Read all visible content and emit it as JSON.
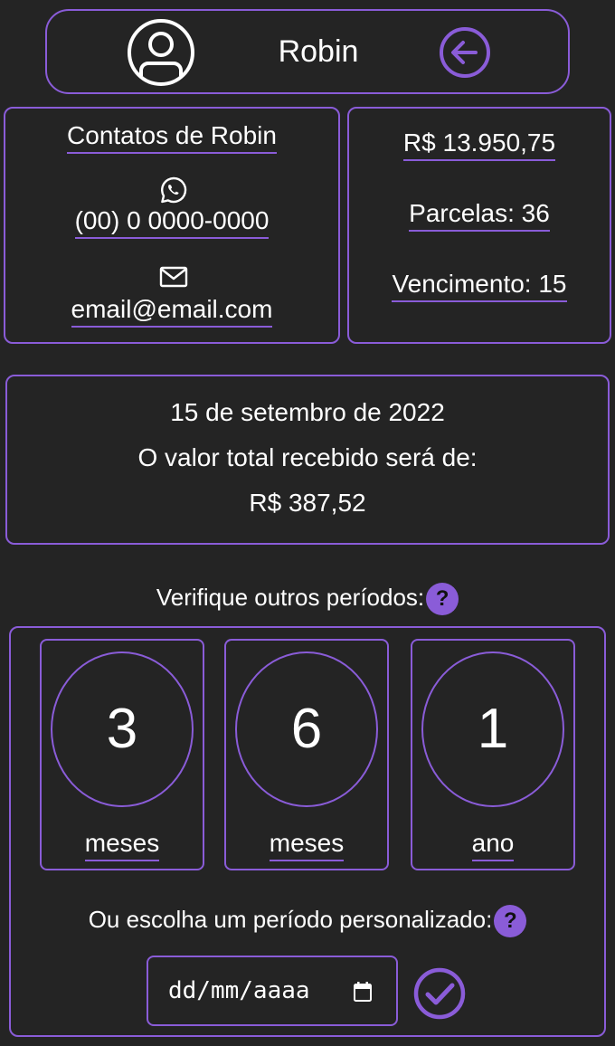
{
  "header": {
    "name": "Robin"
  },
  "contacts": {
    "title": "Contatos de Robin",
    "phone": "(00) 0 0000-0000",
    "email": "email@email.com"
  },
  "finance": {
    "valor": "R$ 13.950,75",
    "parcelas": "Parcelas: 36",
    "vencimento": "Vencimento: 15"
  },
  "summary": {
    "date": "15 de setembro de 2022",
    "text": "O valor total recebido será de:",
    "amount": "R$ 387,52"
  },
  "periods": {
    "title": "Verifique outros períodos:",
    "help": "?",
    "options": [
      {
        "number": "3",
        "unit": "meses"
      },
      {
        "number": "6",
        "unit": "meses"
      },
      {
        "number": "1",
        "unit": "ano"
      }
    ],
    "custom_label": "Ou escolha um período personalizado:",
    "date_placeholder": "dd/mm/aaaa"
  },
  "icons": {
    "avatar": "user-circle-icon",
    "back": "arrow-left-circle-icon",
    "whatsapp": "whatsapp-icon",
    "mail": "envelope-icon",
    "help": "question-circle-icon",
    "calendar": "calendar-icon",
    "confirm": "check-circle-icon"
  },
  "colors": {
    "accent": "#8a5cd8",
    "background": "#242424",
    "text": "#ffffff"
  }
}
